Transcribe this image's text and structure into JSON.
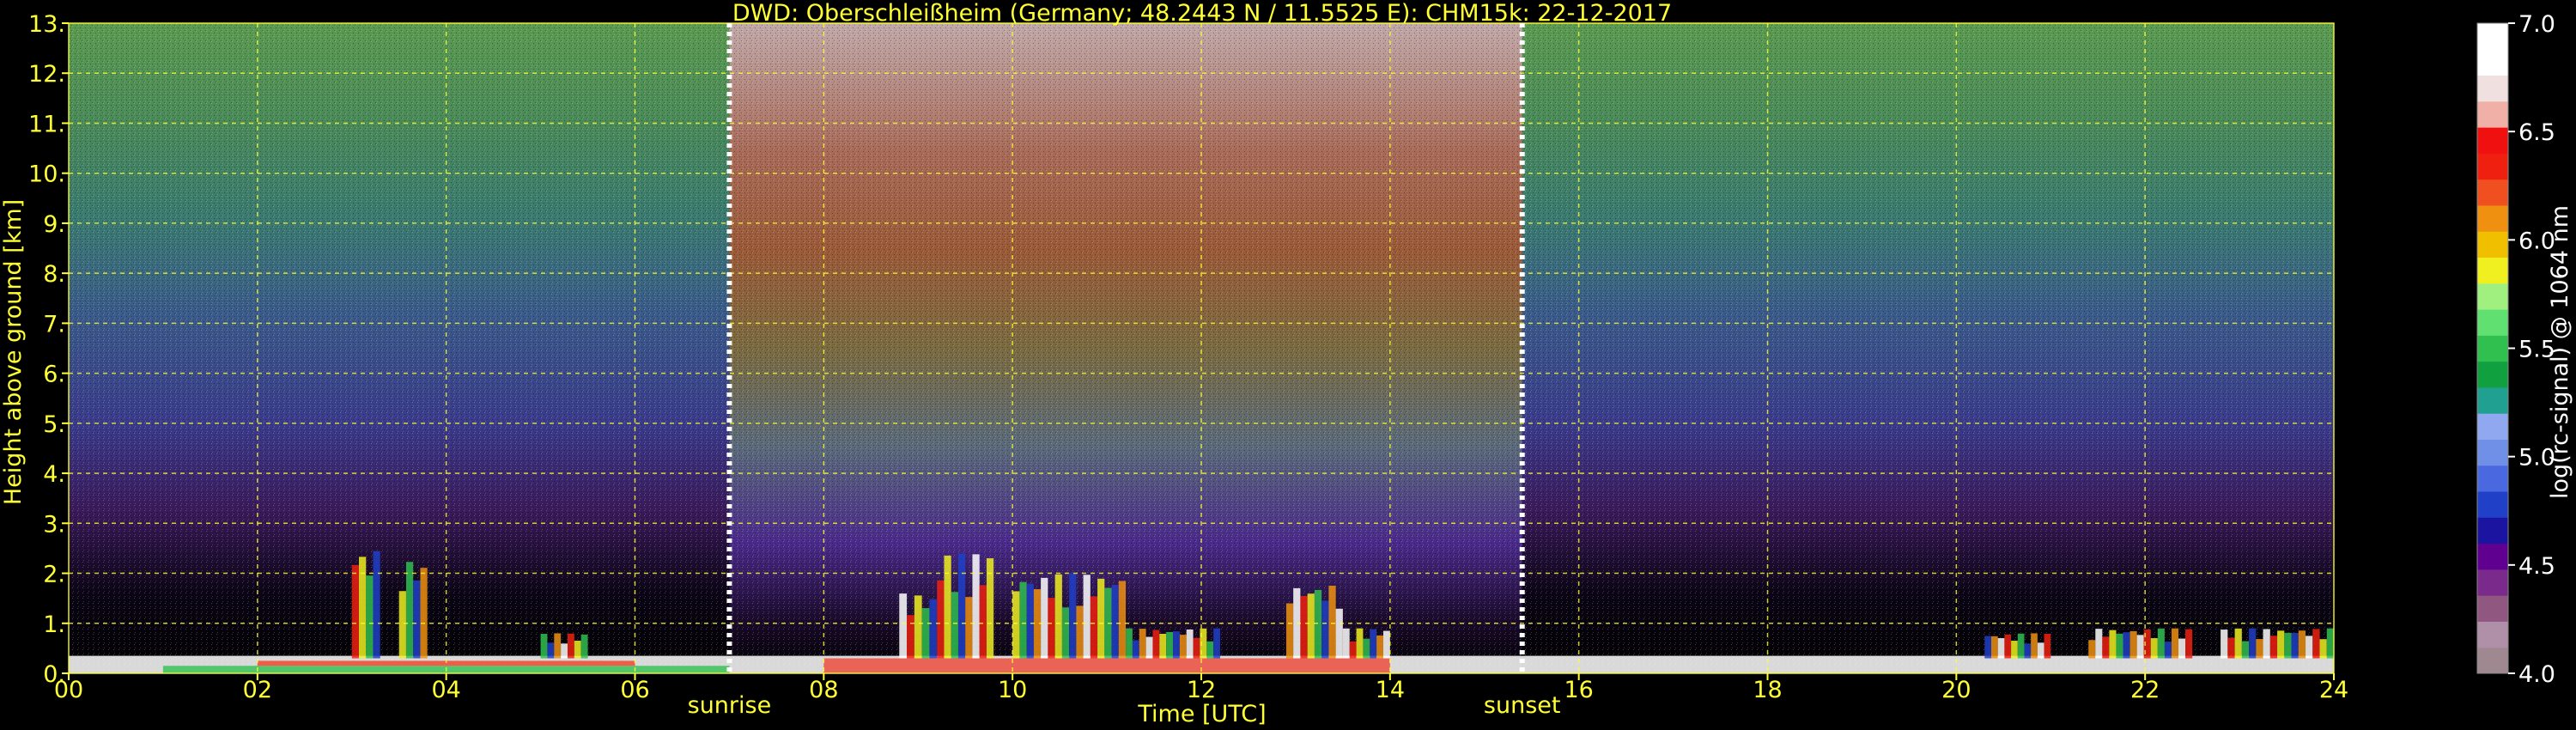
{
  "chart_data": {
    "type": "heatmap",
    "title": "DWD: Oberschleißheim (Germany; 48.2443 N / 11.5525 E):    CHM15k: 22-12-2017",
    "xlabel": "Time [UTC]",
    "ylabel": "Height above ground [km]",
    "xlim": [
      0,
      24
    ],
    "ylim": [
      0,
      13
    ],
    "x_ticks": [
      "00",
      "02",
      "04",
      "06",
      "08",
      "10",
      "12",
      "14",
      "16",
      "18",
      "20",
      "22",
      "24"
    ],
    "y_ticks": [
      "0.",
      "1.",
      "2.",
      "3.",
      "4.",
      "5.",
      "6.",
      "7.",
      "8.",
      "9.",
      "10.",
      "11.",
      "12.",
      "13."
    ],
    "grid": true,
    "markers": [
      {
        "label": "sunrise",
        "x": 7.0
      },
      {
        "label": "sunset",
        "x": 15.4
      }
    ],
    "colorbar": {
      "label": "log(rc-signal) @ 1064 nm",
      "range": [
        4.0,
        7.0
      ],
      "ticks": [
        "4.0",
        "4.5",
        "5.0",
        "5.5",
        "6.0",
        "6.5",
        "7.0"
      ],
      "colors": [
        "#a08890",
        "#b090a8",
        "#905880",
        "#7a2a8a",
        "#600090",
        "#1a14a0",
        "#2040c8",
        "#4a68e0",
        "#7090e8",
        "#90a8f0",
        "#20a090",
        "#10a040",
        "#30c050",
        "#60e070",
        "#a0f080",
        "#f0f020",
        "#f0c000",
        "#f09010",
        "#f05020",
        "#f02010",
        "#f01010",
        "#f0b0a8",
        "#f0e0e0",
        "#ffffff",
        "#ffffff"
      ]
    },
    "background_profile": {
      "description_free": true,
      "time_mid_day": [
        7.0,
        15.4
      ]
    },
    "features": [
      {
        "x0": 8.8,
        "x1": 9.2,
        "h": 1.6
      },
      {
        "x0": 9.2,
        "x1": 9.8,
        "h": 2.4
      },
      {
        "x0": 10.0,
        "x1": 11.2,
        "h": 2.0
      },
      {
        "x0": 11.2,
        "x1": 12.2,
        "h": 0.9
      },
      {
        "x0": 12.2,
        "x1": 12.9,
        "h": 0.3
      },
      {
        "x0": 12.9,
        "x1": 13.5,
        "h": 1.8
      },
      {
        "x0": 13.5,
        "x1": 14.0,
        "h": 0.9
      },
      {
        "x0": 3.0,
        "x1": 3.3,
        "h": 2.5
      },
      {
        "x0": 3.5,
        "x1": 3.8,
        "h": 2.3
      },
      {
        "x0": 5.0,
        "x1": 5.5,
        "h": 0.8
      },
      {
        "x0": 20.3,
        "x1": 21.0,
        "h": 0.8
      },
      {
        "x0": 21.4,
        "x1": 22.5,
        "h": 0.9
      },
      {
        "x0": 22.8,
        "x1": 24.0,
        "h": 0.9
      }
    ]
  }
}
